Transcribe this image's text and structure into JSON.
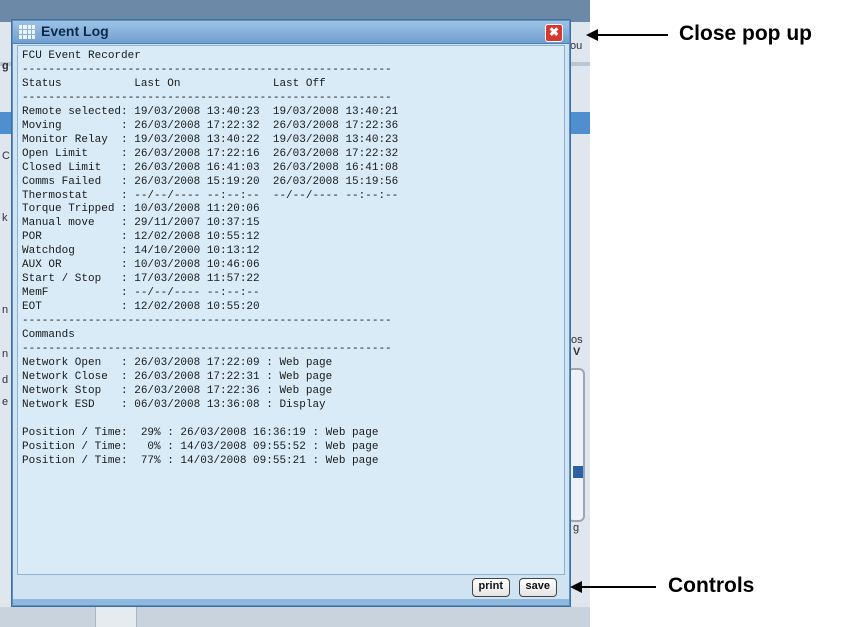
{
  "window": {
    "title": "Event Log",
    "close_glyph": "✖",
    "log_text": "FCU Event Recorder\n--------------------------------------------------------\nStatus           Last On              Last Off\n--------------------------------------------------------\nRemote selected: 19/03/2008 13:40:23  19/03/2008 13:40:21\nMoving         : 26/03/2008 17:22:32  26/03/2008 17:22:36\nMonitor Relay  : 19/03/2008 13:40:22  19/03/2008 13:40:23\nOpen Limit     : 26/03/2008 17:22:16  26/03/2008 17:22:32\nClosed Limit   : 26/03/2008 16:41:03  26/03/2008 16:41:08\nComms Failed   : 26/03/2008 15:19:20  26/03/2008 15:19:56\nThermostat     : --/--/---- --:--:--  --/--/---- --:--:--\nTorque Tripped : 10/03/2008 11:20:06\nManual move    : 29/11/2007 10:37:15\nPOR            : 12/02/2008 10:55:12\nWatchdog       : 14/10/2000 10:13:12\nAUX OR         : 10/03/2008 10:46:06\nStart / Stop   : 17/03/2008 11:57:22\nMemF           : --/--/---- --:--:--\nEOT            : 12/02/2008 10:55:20\n--------------------------------------------------------\nCommands\n--------------------------------------------------------\nNetwork Open   : 26/03/2008 17:22:09 : Web page\nNetwork Close  : 26/03/2008 17:22:31 : Web page\nNetwork Stop   : 26/03/2008 17:22:36 : Web page\nNetwork ESD    : 06/03/2008 13:36:08 : Display\n\nPosition / Time:  29% : 26/03/2008 16:36:19 : Web page\nPosition / Time:   0% : 14/03/2008 09:55:52 : Web page\nPosition / Time:  77% : 14/03/2008 09:55:21 : Web page"
  },
  "controls": {
    "print_label": "print",
    "save_label": "save"
  },
  "annotations": {
    "close_popup": "Close pop up",
    "controls": "Controls"
  },
  "background_fragments": {
    "top_right": "ou",
    "letter_g": "g",
    "letter_c": "C",
    "letter_k": "k",
    "letter_n1": "n",
    "letter_n2": "n",
    "letter_d": "d",
    "letter_e": "e",
    "right_os": "os",
    "right_v": "V",
    "right_g": "g"
  },
  "colors": {
    "popup_bg": "#cfe3f2",
    "titlebar_accent": "#6f9fcf",
    "close_button": "#d7372c"
  },
  "icons": {
    "title": "grid-app-icon",
    "close": "close-icon"
  }
}
